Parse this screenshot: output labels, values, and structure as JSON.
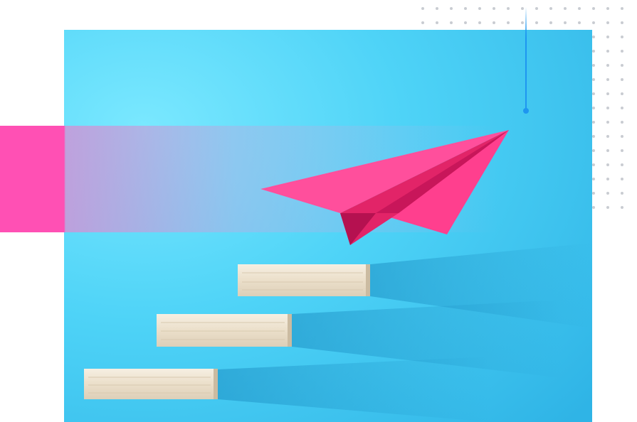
{
  "scene": {
    "subject": "paper-airplane",
    "colors": {
      "background": "#ffffff",
      "sky_blue": "#4ed3f7",
      "deep_blue": "#2fb8ea",
      "accent_pink": "#ff4fb4",
      "plane_pink": "#ff3f8e",
      "plane_shadow": "#d4195a",
      "wood": "#efe5d4",
      "pin_blue": "#1e96f0",
      "dot_gray": "#c9ccd2"
    }
  }
}
